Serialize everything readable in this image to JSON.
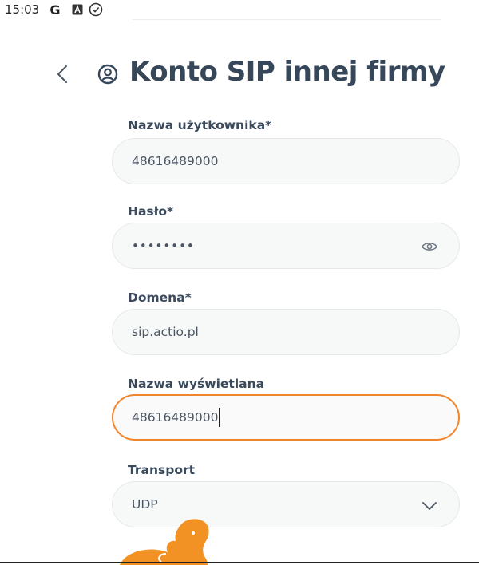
{
  "status_bar": {
    "time": "15:03",
    "icons": [
      "google-icon",
      "a-square-icon",
      "check-circle-icon"
    ]
  },
  "header": {
    "back_icon": "chevron-left-icon",
    "title_icon": "user-circle-icon",
    "title": "Konto SIP innej firmy"
  },
  "form": {
    "username": {
      "label": "Nazwa użytkownika*",
      "value": "48616489000"
    },
    "password": {
      "label": "Hasło*",
      "value": "••••••••",
      "toggle_icon": "eye-icon"
    },
    "domain": {
      "label": "Domena*",
      "value": "sip.actio.pl"
    },
    "display_name": {
      "label": "Nazwa wyświetlana",
      "value": "48616489000"
    },
    "transport": {
      "label": "Transport",
      "value": "UDP",
      "dropdown_icon": "chevron-down-icon"
    }
  },
  "colors": {
    "accent": "#f0852d",
    "title": "#36475a",
    "field_background": "#f7f8f8"
  },
  "decoration": {
    "mascot_icon": "orange-mascot-icon"
  }
}
